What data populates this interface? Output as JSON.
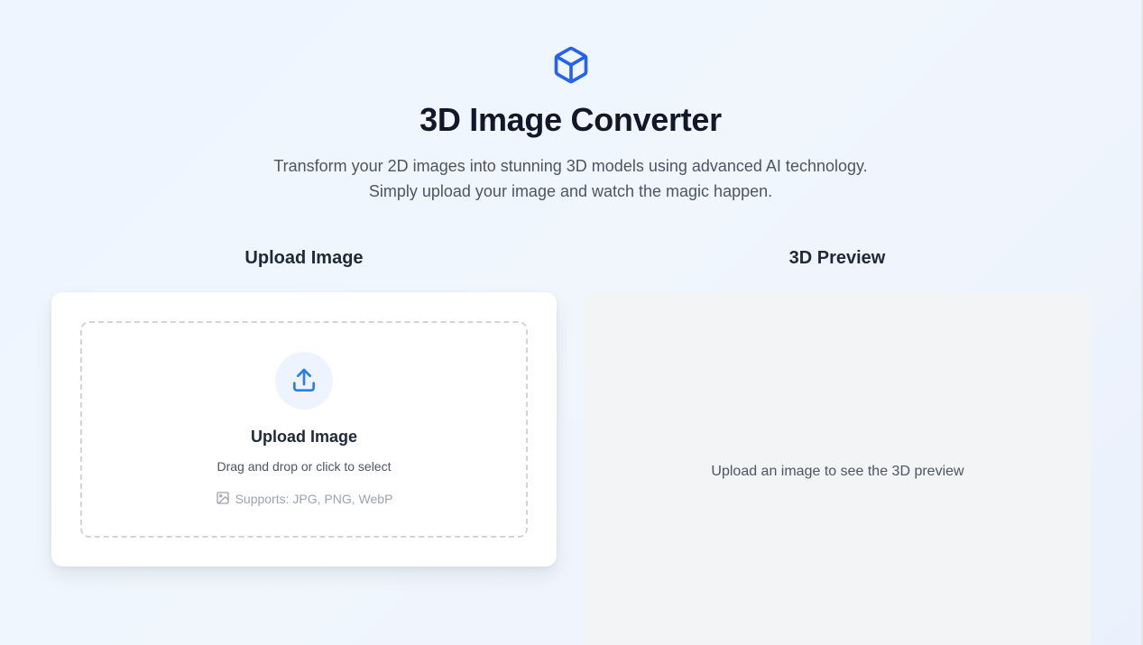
{
  "header": {
    "logo_icon": "cube-icon",
    "title": "3D Image Converter",
    "subtitle_line1": "Transform your 2D images into stunning 3D models using advanced AI technology.",
    "subtitle_line2": "Simply upload your image and watch the magic happen."
  },
  "upload": {
    "heading": "Upload Image",
    "dropzone": {
      "icon": "upload-icon",
      "title": "Upload Image",
      "hint": "Drag and drop or click to select",
      "support_icon": "image-icon",
      "support_text": "Supports: JPG, PNG, WebP"
    }
  },
  "preview": {
    "heading": "3D Preview",
    "placeholder": "Upload an image to see the 3D preview"
  },
  "colors": {
    "accent": "#2563eb",
    "background": "#eef5fe",
    "card": "#ffffff",
    "preview_bg": "#f3f4f6"
  }
}
